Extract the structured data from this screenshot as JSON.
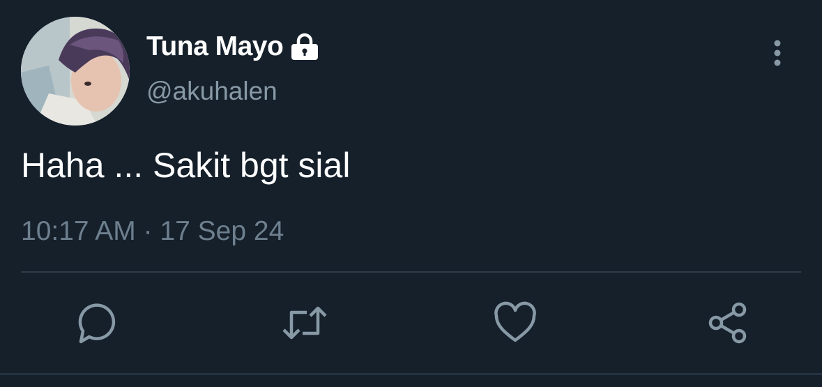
{
  "user": {
    "display_name": "Tuna Mayo",
    "handle": "@akuhalen",
    "protected_icon": "lock-icon",
    "avatar": "profile-photo"
  },
  "tweet": {
    "text": "Haha ... Sakit bgt sial",
    "timestamp": "10:17 AM · 17 Sep 24"
  },
  "actions": [
    {
      "name": "reply",
      "icon": "comment-icon"
    },
    {
      "name": "retweet",
      "icon": "retweet-icon"
    },
    {
      "name": "like",
      "icon": "heart-icon"
    },
    {
      "name": "share",
      "icon": "share-icon"
    }
  ],
  "menu_icon": "more-vertical-icon",
  "colors": {
    "background": "#15202b",
    "primary_text": "#ffffff",
    "secondary_text": "#8899a6",
    "icon": "#8899a6",
    "divider": "#2f3d4a"
  }
}
